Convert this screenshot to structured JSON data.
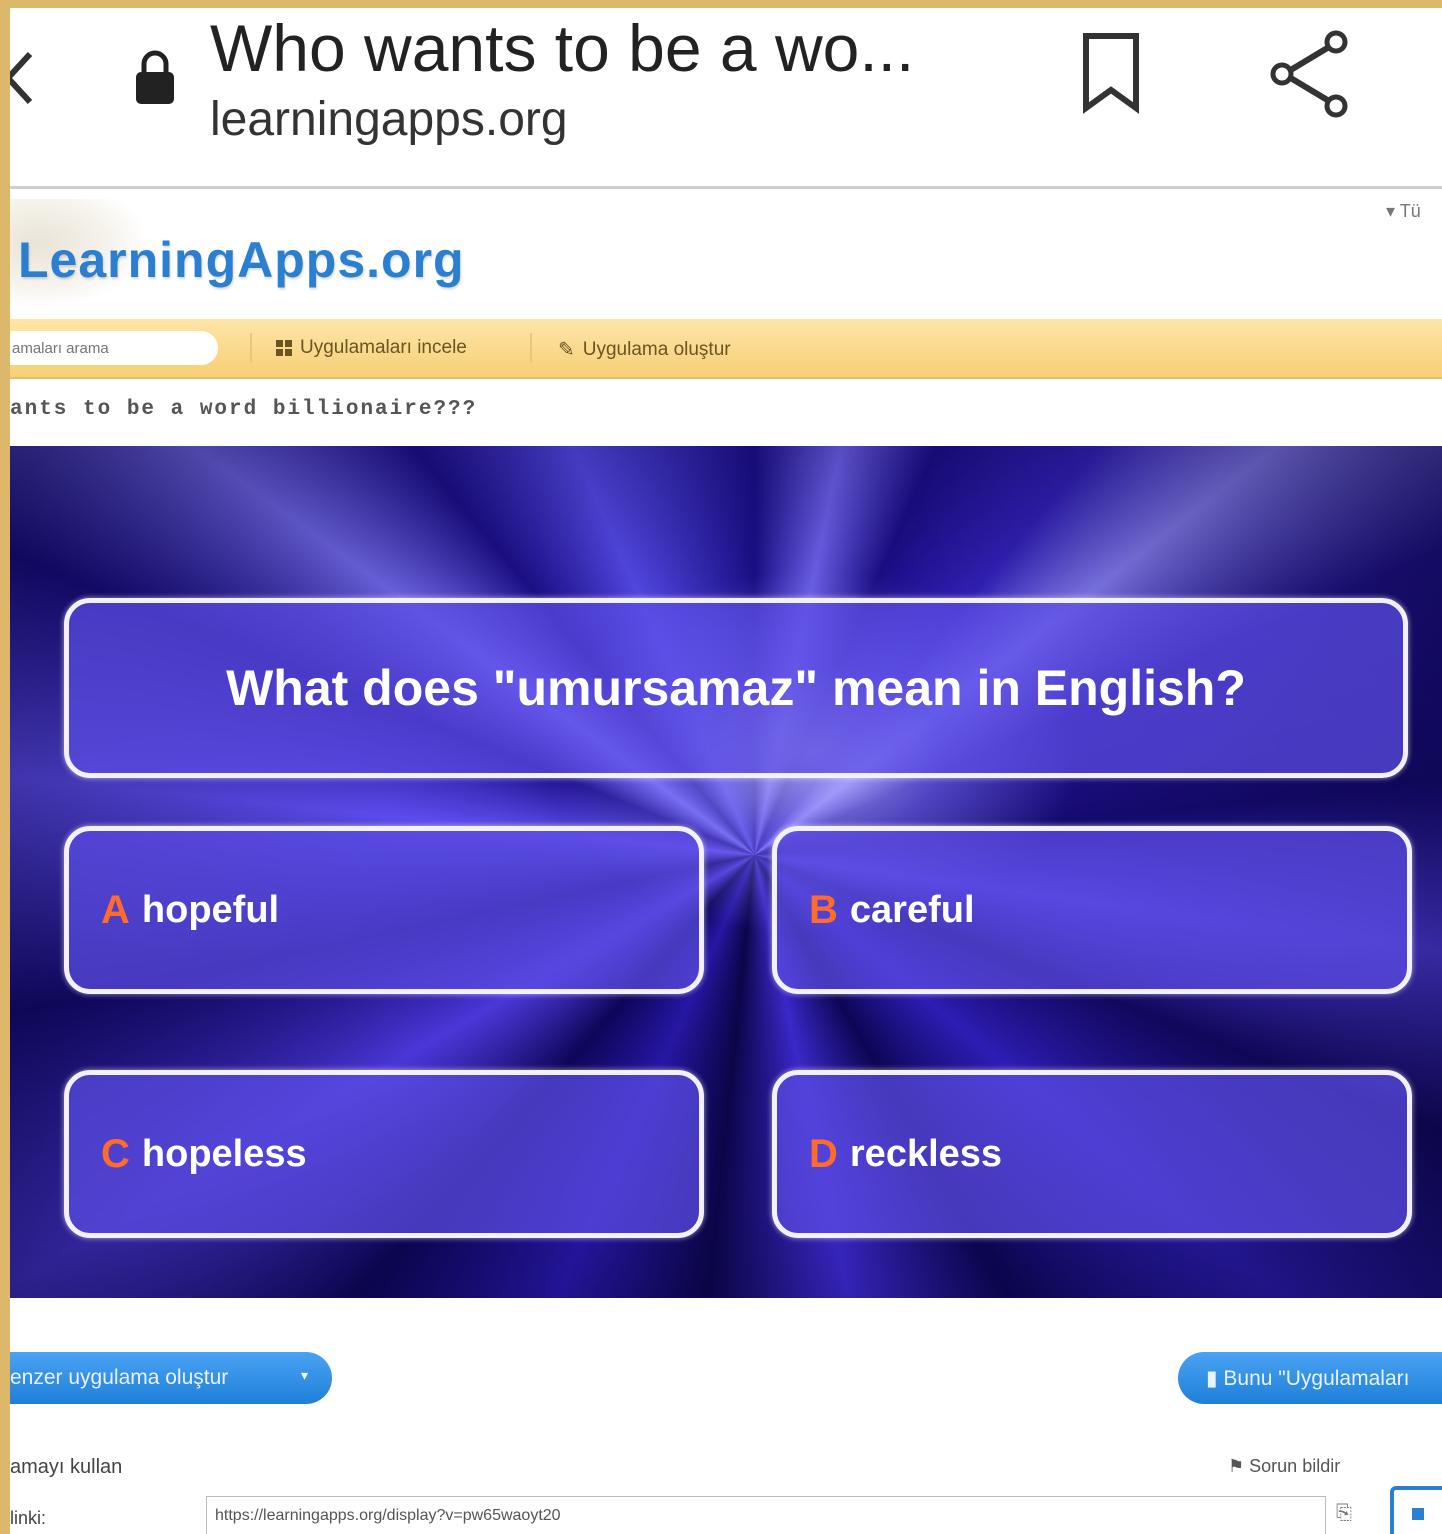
{
  "browser": {
    "title": "Who wants to be a wo...",
    "domain": "learningapps.org"
  },
  "site": {
    "logo": "LearningApps.org",
    "corner_menu": "▾ Tü"
  },
  "nav": {
    "search_placeholder": "amaları arama",
    "browse_label": "Uygulamaları incele",
    "create_label": "Uygulama oluştur"
  },
  "app": {
    "heading": "ants to be a word billionaire???"
  },
  "game": {
    "question": "What does \"umursamaz\" mean in English?",
    "answers": [
      {
        "letter": "A",
        "text": "hopeful"
      },
      {
        "letter": "B",
        "text": "careful"
      },
      {
        "letter": "C",
        "text": "hopeless"
      },
      {
        "letter": "D",
        "text": "reckless"
      }
    ]
  },
  "footer": {
    "similar_button": "enzer uygulama oluştur",
    "save_button": "Bunu \"Uygulamaları",
    "use_label": "amayı kullan",
    "report_label": "Sorun bildir",
    "link_label": "linki:",
    "url_value": "https://learningapps.org/display?v=pw65waoyt20"
  },
  "colors": {
    "accent": "#2a7fd0",
    "nav_strip": "#f7cf76",
    "answer_letter": "#ff6b2a",
    "frame_border": "#ddb86a"
  }
}
